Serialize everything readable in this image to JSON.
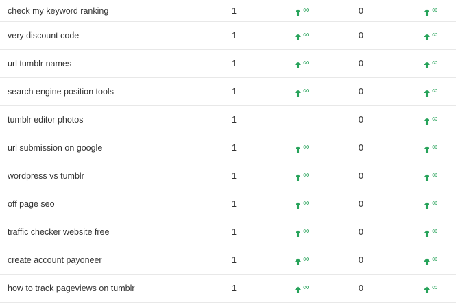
{
  "colors": {
    "accent": "#27a35a",
    "text": "#333333",
    "divider": "#e8e8e8"
  },
  "rows": [
    {
      "keyword": "check my keyword ranking",
      "position": "1",
      "change1": "∞",
      "change1_visible": true,
      "current": "0",
      "change2": "∞"
    },
    {
      "keyword": "very discount code",
      "position": "1",
      "change1": "∞",
      "change1_visible": true,
      "current": "0",
      "change2": "∞"
    },
    {
      "keyword": "url tumblr names",
      "position": "1",
      "change1": "∞",
      "change1_visible": true,
      "current": "0",
      "change2": "∞"
    },
    {
      "keyword": "search engine position tools",
      "position": "1",
      "change1": "∞",
      "change1_visible": true,
      "current": "0",
      "change2": "∞"
    },
    {
      "keyword": "tumblr editor photos",
      "position": "1",
      "change1": "",
      "change1_visible": false,
      "current": "0",
      "change2": "∞"
    },
    {
      "keyword": "url submission on google",
      "position": "1",
      "change1": "∞",
      "change1_visible": true,
      "current": "0",
      "change2": "∞"
    },
    {
      "keyword": "wordpress vs tumblr",
      "position": "1",
      "change1": "∞",
      "change1_visible": true,
      "current": "0",
      "change2": "∞"
    },
    {
      "keyword": "off page seo",
      "position": "1",
      "change1": "∞",
      "change1_visible": true,
      "current": "0",
      "change2": "∞"
    },
    {
      "keyword": "traffic checker website free",
      "position": "1",
      "change1": "∞",
      "change1_visible": true,
      "current": "0",
      "change2": "∞"
    },
    {
      "keyword": "create account payoneer",
      "position": "1",
      "change1": "∞",
      "change1_visible": true,
      "current": "0",
      "change2": "∞"
    },
    {
      "keyword": "how to track pageviews on tumblr",
      "position": "1",
      "change1": "∞",
      "change1_visible": true,
      "current": "0",
      "change2": "∞"
    }
  ]
}
